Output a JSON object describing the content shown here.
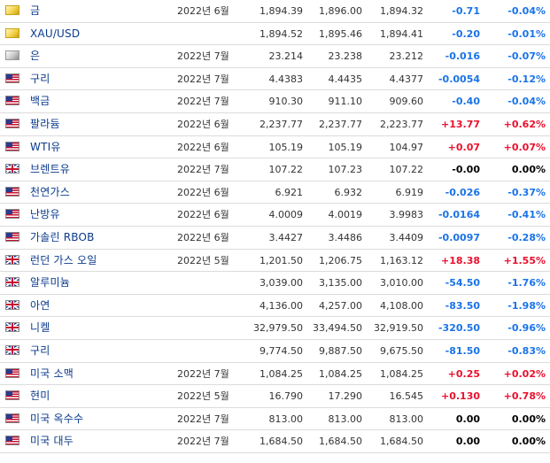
{
  "colors": {
    "negative": "#1a73e8",
    "positive": "#e8112d",
    "neutral": "#000000",
    "name_link": "#0a3a8c"
  },
  "rows": [
    {
      "flag": "gold-icon",
      "name": "금",
      "month": "2022년 6월",
      "last": "1,894.39",
      "high": "1,896.00",
      "low": "1,894.32",
      "change": "-0.71",
      "pct": "-0.04%",
      "dir": "neg"
    },
    {
      "flag": "gold-icon",
      "name": "XAU/USD",
      "month": "",
      "last": "1,894.52",
      "high": "1,895.46",
      "low": "1,894.41",
      "change": "-0.20",
      "pct": "-0.01%",
      "dir": "neg"
    },
    {
      "flag": "silver-icon",
      "name": "은",
      "month": "2022년 7월",
      "last": "23.214",
      "high": "23.238",
      "low": "23.212",
      "change": "-0.016",
      "pct": "-0.07%",
      "dir": "neg"
    },
    {
      "flag": "us-flag-icon",
      "name": "구리",
      "month": "2022년 7월",
      "last": "4.4383",
      "high": "4.4435",
      "low": "4.4377",
      "change": "-0.0054",
      "pct": "-0.12%",
      "dir": "neg"
    },
    {
      "flag": "us-flag-icon",
      "name": "백금",
      "month": "2022년 7월",
      "last": "910.30",
      "high": "911.10",
      "low": "909.60",
      "change": "-0.40",
      "pct": "-0.04%",
      "dir": "neg"
    },
    {
      "flag": "us-flag-icon",
      "name": "팔라듐",
      "month": "2022년 6월",
      "last": "2,237.77",
      "high": "2,237.77",
      "low": "2,223.77",
      "change": "+13.77",
      "pct": "+0.62%",
      "dir": "pos"
    },
    {
      "flag": "us-flag-icon",
      "name": "WTI유",
      "month": "2022년 6월",
      "last": "105.19",
      "high": "105.19",
      "low": "104.97",
      "change": "+0.07",
      "pct": "+0.07%",
      "dir": "pos"
    },
    {
      "flag": "uk-flag-icon",
      "name": "브렌트유",
      "month": "2022년 7월",
      "last": "107.22",
      "high": "107.23",
      "low": "107.22",
      "change": "-0.00",
      "pct": "0.00%",
      "dir": "zero"
    },
    {
      "flag": "us-flag-icon",
      "name": "천연가스",
      "month": "2022년 6월",
      "last": "6.921",
      "high": "6.932",
      "low": "6.919",
      "change": "-0.026",
      "pct": "-0.37%",
      "dir": "neg"
    },
    {
      "flag": "us-flag-icon",
      "name": "난방유",
      "month": "2022년 6월",
      "last": "4.0009",
      "high": "4.0019",
      "low": "3.9983",
      "change": "-0.0164",
      "pct": "-0.41%",
      "dir": "neg"
    },
    {
      "flag": "us-flag-icon",
      "name": "가솔린 RBOB",
      "month": "2022년 6월",
      "last": "3.4427",
      "high": "3.4486",
      "low": "3.4409",
      "change": "-0.0097",
      "pct": "-0.28%",
      "dir": "neg"
    },
    {
      "flag": "uk-flag-icon",
      "name": "런던 가스 오일",
      "month": "2022년 5월",
      "last": "1,201.50",
      "high": "1,206.75",
      "low": "1,163.12",
      "change": "+18.38",
      "pct": "+1.55%",
      "dir": "pos"
    },
    {
      "flag": "uk-flag-icon",
      "name": "알루미늄",
      "month": "",
      "last": "3,039.00",
      "high": "3,135.00",
      "low": "3,010.00",
      "change": "-54.50",
      "pct": "-1.76%",
      "dir": "neg"
    },
    {
      "flag": "uk-flag-icon",
      "name": "아연",
      "month": "",
      "last": "4,136.00",
      "high": "4,257.00",
      "low": "4,108.00",
      "change": "-83.50",
      "pct": "-1.98%",
      "dir": "neg"
    },
    {
      "flag": "uk-flag-icon",
      "name": "니켈",
      "month": "",
      "last": "32,979.50",
      "high": "33,494.50",
      "low": "32,919.50",
      "change": "-320.50",
      "pct": "-0.96%",
      "dir": "neg"
    },
    {
      "flag": "uk-flag-icon",
      "name": "구리",
      "month": "",
      "last": "9,774.50",
      "high": "9,887.50",
      "low": "9,675.50",
      "change": "-81.50",
      "pct": "-0.83%",
      "dir": "neg"
    },
    {
      "flag": "us-flag-icon",
      "name": "미국 소맥",
      "month": "2022년 7월",
      "last": "1,084.25",
      "high": "1,084.25",
      "low": "1,084.25",
      "change": "+0.25",
      "pct": "+0.02%",
      "dir": "pos"
    },
    {
      "flag": "us-flag-icon",
      "name": "현미",
      "month": "2022년 5월",
      "last": "16.790",
      "high": "17.290",
      "low": "16.545",
      "change": "+0.130",
      "pct": "+0.78%",
      "dir": "pos"
    },
    {
      "flag": "us-flag-icon",
      "name": "미국 옥수수",
      "month": "2022년 7월",
      "last": "813.00",
      "high": "813.00",
      "low": "813.00",
      "change": "0.00",
      "pct": "0.00%",
      "dir": "zero"
    },
    {
      "flag": "us-flag-icon",
      "name": "미국 대두",
      "month": "2022년 7월",
      "last": "1,684.50",
      "high": "1,684.50",
      "low": "1,684.50",
      "change": "0.00",
      "pct": "0.00%",
      "dir": "zero"
    }
  ]
}
